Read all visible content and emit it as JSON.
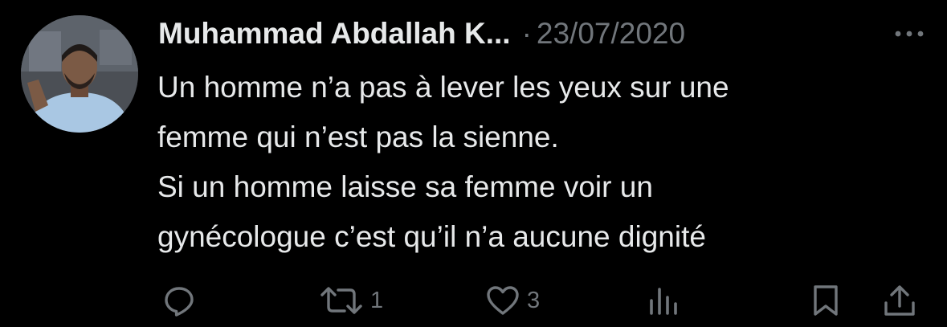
{
  "tweet": {
    "author_name": "Muhammad Abdallah K...",
    "separator": "·",
    "date": "23/07/2020",
    "text_lines": [
      "Un homme n’a pas à lever les yeux sur une",
      "femme qui n’est pas la sienne.",
      "Si un homme laisse sa femme voir un",
      "gynécologue c’est qu’il n’a aucune dignité"
    ]
  },
  "actions": {
    "reply_icon": "reply-icon",
    "retweet_icon": "retweet-icon",
    "retweet_count": "1",
    "like_icon": "heart-icon",
    "like_count": "3",
    "views_icon": "views-icon",
    "bookmark_icon": "bookmark-icon",
    "share_icon": "share-icon"
  },
  "colors": {
    "background": "#000000",
    "text_primary": "#e7e9ea",
    "text_secondary": "#71767b"
  }
}
